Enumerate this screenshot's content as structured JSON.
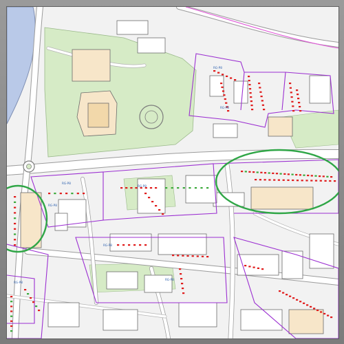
{
  "map": {
    "colors": {
      "frame": "#8a8a8a",
      "background": "#f2f2f2",
      "water": "#b9c9e8",
      "park": "#d6ebc6",
      "building_fill": "#f7e6c9",
      "building_outline": "#6b6b6b",
      "road_outline": "#9b9b9b",
      "boundary_purple": "#9b2fd1",
      "highlight_green": "#2fa646",
      "parking_red": "#e01b1b",
      "parking_green": "#3aa93a",
      "label_blue": "#2b5fae"
    },
    "highlight_count": 2,
    "labels": [
      "RG-P8",
      "RG-P8",
      "RG-P8",
      "RG-P8",
      "RG-P8",
      "RG-P8",
      "RG-P8",
      "RG-P8"
    ]
  }
}
